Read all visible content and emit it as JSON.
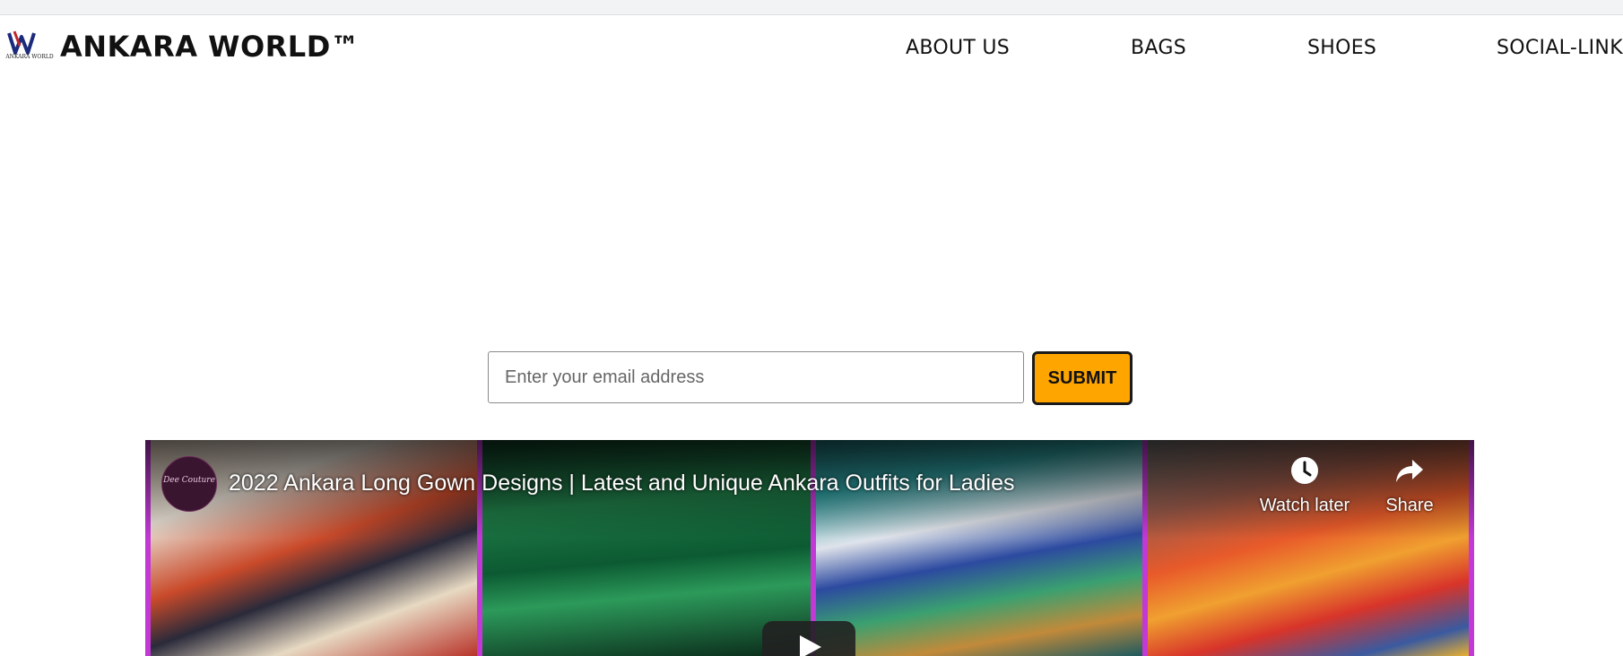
{
  "brand": {
    "name": "ANKARA WORLD™",
    "logo_text": "ANKARA WORLD"
  },
  "nav": {
    "items": [
      {
        "label": "ABOUT US"
      },
      {
        "label": "BAGS"
      },
      {
        "label": "SHOES"
      },
      {
        "label": "SOCIAL-LINKS"
      }
    ]
  },
  "subscribe": {
    "email_placeholder": "Enter your email address",
    "email_value": "",
    "submit_label": "SUBMIT",
    "submit_color": "#ffa500"
  },
  "video": {
    "channel_avatar_text": "Dee Couture",
    "title": "2022 Ankara Long Gown Designs | Latest and Unique Ankara Outfits for Ladies",
    "watch_later_label": "Watch later",
    "watch_later_icon": "clock-icon",
    "share_label": "Share",
    "share_icon": "share-arrow-icon",
    "play_icon": "play-icon",
    "frame_border_color": "#c239d6"
  }
}
